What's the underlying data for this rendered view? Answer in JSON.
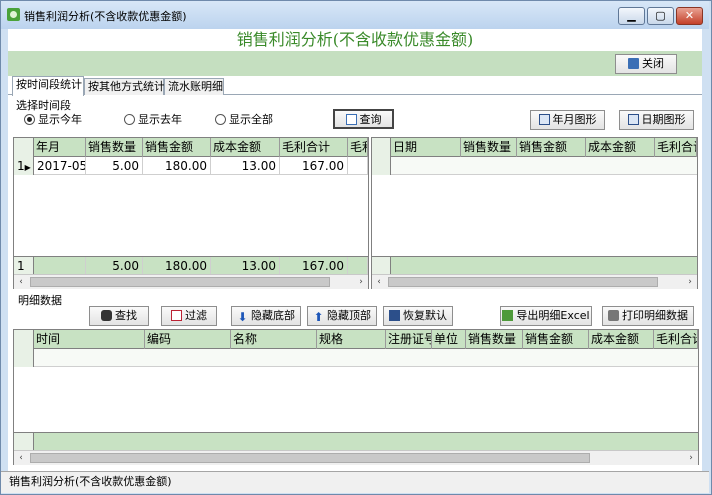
{
  "window": {
    "title": "销售利润分析(不含收款优惠金额)",
    "minimize": "▁",
    "maximize": "▢",
    "close": "✕"
  },
  "banner": {
    "title": "销售利润分析(不含收款优惠金额)"
  },
  "toolbar": {
    "close_label": "关闭"
  },
  "tabs": [
    {
      "label": "按时间段统计",
      "active": true
    },
    {
      "label": "按其他方式统计",
      "active": false
    },
    {
      "label": "流水账明细",
      "active": false
    }
  ],
  "period": {
    "group_label": "选择时间段",
    "options": [
      {
        "label": "显示今年",
        "selected": true
      },
      {
        "label": "显示去年",
        "selected": false
      },
      {
        "label": "显示全部",
        "selected": false
      }
    ],
    "query_label": "查询",
    "month_chart_label": "年月图形",
    "day_chart_label": "日期图形"
  },
  "month_grid": {
    "columns": [
      "年月",
      "销售数量",
      "销售金额",
      "成本金额",
      "毛利合计",
      "毛利"
    ],
    "rows": [
      {
        "index": "1",
        "cells": [
          "2017-05",
          "5.00",
          "180.00",
          "13.00",
          "167.00",
          ""
        ]
      }
    ],
    "footer": {
      "index": "1",
      "cells": [
        "",
        "5.00",
        "180.00",
        "13.00",
        "167.00",
        ""
      ]
    }
  },
  "day_grid": {
    "columns": [
      "日期",
      "销售数量",
      "销售金额",
      "成本金额",
      "毛利合计"
    ]
  },
  "detail": {
    "section_label": "明细数据",
    "buttons": {
      "find": "查找",
      "filter": "过滤",
      "hide_bottom": "隐藏底部",
      "hide_top": "隐藏顶部",
      "restore": "恢复默认",
      "export_excel": "导出明细Excel",
      "print": "打印明细数据"
    },
    "columns": [
      "时间",
      "编码",
      "名称",
      "规格",
      "注册证号",
      "单位",
      "销售数量",
      "销售金额",
      "成本金额",
      "毛利合计"
    ]
  },
  "status": {
    "text": "销售利润分析(不含收款优惠金额)"
  },
  "scroll": {
    "left": "‹",
    "right": "›"
  }
}
